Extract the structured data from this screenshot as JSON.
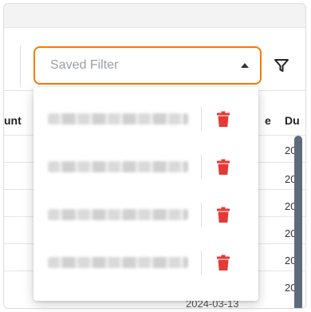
{
  "colors": {
    "accent": "#f57c00",
    "danger": "#e53935",
    "scrollbar": "#5f6b7a"
  },
  "toolbar": {
    "saved_filter": {
      "placeholder": "Saved Filter",
      "caret": "caret-up-icon"
    },
    "filter_button": {
      "icon": "filter-icon"
    }
  },
  "table": {
    "headers": [
      "unt",
      "e",
      "Du"
    ],
    "date_cells": [
      "20",
      "20",
      "20",
      "20",
      "20",
      "20"
    ],
    "bottom_text": "2024-03-13"
  },
  "saved_filters": {
    "items": [
      {
        "label": "",
        "delete_icon": "trash-icon"
      },
      {
        "label": "",
        "delete_icon": "trash-icon"
      },
      {
        "label": "",
        "delete_icon": "trash-icon"
      },
      {
        "label": "",
        "delete_icon": "trash-icon"
      }
    ]
  }
}
